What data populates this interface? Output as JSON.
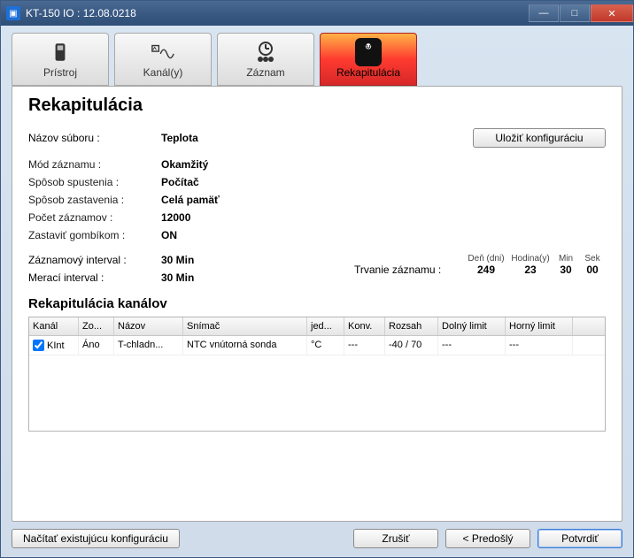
{
  "window": {
    "title": "KT-150 IO : 12.08.0218"
  },
  "tabs": {
    "device": {
      "label": "Prístroj"
    },
    "channels": {
      "label": "Kanál(y)"
    },
    "record": {
      "label": "Záznam"
    },
    "recap": {
      "label": "Rekapitulácia"
    }
  },
  "page": {
    "title": "Rekapitulácia",
    "save_config": "Uložiť konfiguráciu",
    "filename_label": "Názov súboru :",
    "filename_value": "Teplota",
    "mode_label": "Mód záznamu :",
    "mode_value": "Okamžitý",
    "start_label": "Spôsob spustenia :",
    "start_value": "Počítač",
    "stop_label": "Spôsob zastavenia :",
    "stop_value": "Celá pamäť",
    "count_label": "Počet záznamov :",
    "count_value": "12000",
    "button_stop_label": "Zastaviť gombíkom :",
    "button_stop_value": "ON",
    "rec_interval_label": "Záznamový interval :",
    "rec_interval_value": "30 Min",
    "meas_interval_label": "Merací interval :",
    "meas_interval_value": "30 Min",
    "duration_label": "Trvanie záznamu :",
    "dur_head": {
      "days": "Deň (dni)",
      "hours": "Hodina(y)",
      "min": "Min",
      "sec": "Sek"
    },
    "dur_vals": {
      "days": "249",
      "hours": "23",
      "min": "30",
      "sec": "00"
    },
    "channels_title": "Rekapitulácia kanálov"
  },
  "table": {
    "headers": {
      "channel": "Kanál",
      "show": "Zo...",
      "name": "Názov",
      "sensor": "Snímač",
      "unit": "jed...",
      "conv": "Konv.",
      "range": "Rozsah",
      "low": "Dolný limit",
      "high": "Horný limit"
    },
    "rows": [
      {
        "checked": true,
        "channel": "KInt",
        "show": "Áno",
        "name": "T-chladn...",
        "sensor": "NTC vnútorná sonda",
        "unit": "°C",
        "conv": "---",
        "range": "-40 / 70",
        "low": "---",
        "high": "---"
      }
    ]
  },
  "footer": {
    "load": "Načítať existujúcu konfiguráciu",
    "cancel": "Zrušiť",
    "prev": "< Predošlý",
    "confirm": "Potvrdiť"
  }
}
